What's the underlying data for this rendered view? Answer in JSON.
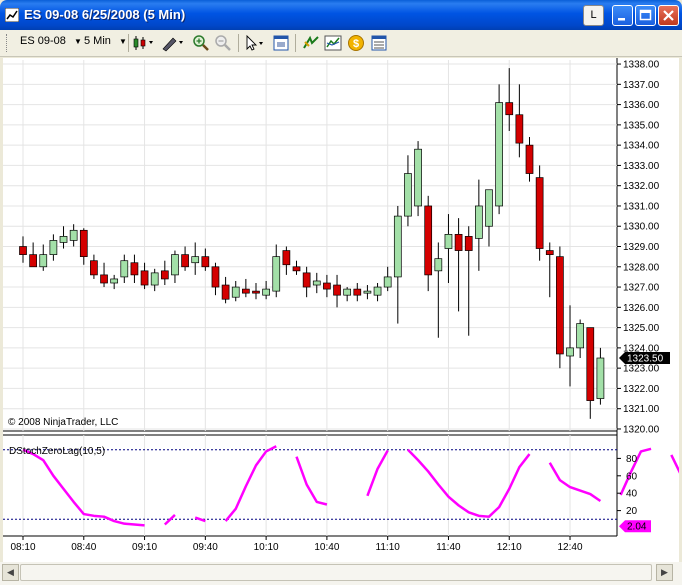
{
  "window": {
    "title": "ES 09-08  6/25/2008 (5 Min)",
    "l_button": "L"
  },
  "toolbar": {
    "instrument": "ES 09-08",
    "interval": "5 Min"
  },
  "colors": {
    "up": "#a3e0a8",
    "down": "#d40000",
    "indicator": "#ff00ff",
    "last_price_bg": "#000000",
    "indicator_last_bg": "#ff00ff"
  },
  "chart_data": [
    {
      "type": "candlestick",
      "price_axis": {
        "ticks": [
          "1338.00",
          "1337.00",
          "1336.00",
          "1335.00",
          "1334.00",
          "1333.00",
          "1332.00",
          "1331.00",
          "1330.00",
          "1329.00",
          "1328.00",
          "1327.00",
          "1326.00",
          "1325.00",
          "1324.00",
          "1323.00",
          "1322.00",
          "1321.00",
          "1320.00"
        ],
        "range": [
          1319.9,
          1338.2
        ]
      },
      "time_axis": {
        "ticks": [
          "08:10",
          "08:40",
          "09:10",
          "09:40",
          "10:10",
          "10:40",
          "11:10",
          "11:40",
          "12:10",
          "12:40"
        ]
      },
      "last_price": "1323.50",
      "copyright": "© 2008 NinjaTrader, LLC",
      "candles": [
        {
          "o": 1329.0,
          "h": 1329.5,
          "l": 1328.2,
          "c": 1328.6
        },
        {
          "o": 1328.6,
          "h": 1329.2,
          "l": 1328.0,
          "c": 1328.0
        },
        {
          "o": 1328.0,
          "h": 1329.1,
          "l": 1327.8,
          "c": 1328.6
        },
        {
          "o": 1328.6,
          "h": 1329.6,
          "l": 1328.3,
          "c": 1329.3
        },
        {
          "o": 1329.2,
          "h": 1330.0,
          "l": 1328.9,
          "c": 1329.5
        },
        {
          "o": 1329.3,
          "h": 1330.1,
          "l": 1329.0,
          "c": 1329.8
        },
        {
          "o": 1329.8,
          "h": 1329.9,
          "l": 1328.1,
          "c": 1328.5
        },
        {
          "o": 1328.3,
          "h": 1328.6,
          "l": 1327.4,
          "c": 1327.6
        },
        {
          "o": 1327.6,
          "h": 1328.2,
          "l": 1327.0,
          "c": 1327.2
        },
        {
          "o": 1327.2,
          "h": 1327.6,
          "l": 1326.9,
          "c": 1327.4
        },
        {
          "o": 1327.5,
          "h": 1328.6,
          "l": 1327.2,
          "c": 1328.3
        },
        {
          "o": 1328.2,
          "h": 1328.6,
          "l": 1327.2,
          "c": 1327.6
        },
        {
          "o": 1327.8,
          "h": 1328.2,
          "l": 1326.9,
          "c": 1327.1
        },
        {
          "o": 1327.1,
          "h": 1327.9,
          "l": 1326.8,
          "c": 1327.7
        },
        {
          "o": 1327.8,
          "h": 1328.3,
          "l": 1327.1,
          "c": 1327.4
        },
        {
          "o": 1327.6,
          "h": 1328.8,
          "l": 1327.2,
          "c": 1328.6
        },
        {
          "o": 1328.6,
          "h": 1329.0,
          "l": 1327.8,
          "c": 1328.0
        },
        {
          "o": 1328.2,
          "h": 1329.2,
          "l": 1327.6,
          "c": 1328.5
        },
        {
          "o": 1328.5,
          "h": 1328.9,
          "l": 1327.8,
          "c": 1328.0
        },
        {
          "o": 1328.0,
          "h": 1328.2,
          "l": 1326.6,
          "c": 1327.0
        },
        {
          "o": 1327.1,
          "h": 1327.5,
          "l": 1326.2,
          "c": 1326.4
        },
        {
          "o": 1326.5,
          "h": 1327.3,
          "l": 1326.3,
          "c": 1327.0
        },
        {
          "o": 1326.9,
          "h": 1327.4,
          "l": 1326.5,
          "c": 1326.7
        },
        {
          "o": 1326.8,
          "h": 1327.2,
          "l": 1326.4,
          "c": 1326.7
        },
        {
          "o": 1326.6,
          "h": 1327.3,
          "l": 1326.4,
          "c": 1326.9
        },
        {
          "o": 1326.8,
          "h": 1329.1,
          "l": 1326.5,
          "c": 1328.5
        },
        {
          "o": 1328.8,
          "h": 1329.0,
          "l": 1327.6,
          "c": 1328.1
        },
        {
          "o": 1328.0,
          "h": 1328.3,
          "l": 1327.6,
          "c": 1327.8
        },
        {
          "o": 1327.7,
          "h": 1328.0,
          "l": 1326.5,
          "c": 1327.0
        },
        {
          "o": 1327.1,
          "h": 1327.7,
          "l": 1326.7,
          "c": 1327.3
        },
        {
          "o": 1327.2,
          "h": 1327.6,
          "l": 1326.5,
          "c": 1326.9
        },
        {
          "o": 1327.1,
          "h": 1327.6,
          "l": 1326.0,
          "c": 1326.6
        },
        {
          "o": 1326.6,
          "h": 1327.0,
          "l": 1326.3,
          "c": 1326.9
        },
        {
          "o": 1326.9,
          "h": 1327.2,
          "l": 1326.3,
          "c": 1326.6
        },
        {
          "o": 1326.7,
          "h": 1327.1,
          "l": 1326.4,
          "c": 1326.8
        },
        {
          "o": 1326.6,
          "h": 1327.2,
          "l": 1326.3,
          "c": 1327.0
        },
        {
          "o": 1327.0,
          "h": 1328.0,
          "l": 1326.8,
          "c": 1327.5
        },
        {
          "o": 1327.5,
          "h": 1331.0,
          "l": 1325.2,
          "c": 1330.5
        },
        {
          "o": 1330.5,
          "h": 1333.5,
          "l": 1330.0,
          "c": 1332.6
        },
        {
          "o": 1331.0,
          "h": 1334.2,
          "l": 1330.5,
          "c": 1333.8
        },
        {
          "o": 1331.0,
          "h": 1331.5,
          "l": 1326.8,
          "c": 1327.6
        },
        {
          "o": 1327.8,
          "h": 1329.2,
          "l": 1324.5,
          "c": 1328.4
        },
        {
          "o": 1328.9,
          "h": 1330.6,
          "l": 1327.2,
          "c": 1329.6
        },
        {
          "o": 1329.6,
          "h": 1330.4,
          "l": 1325.8,
          "c": 1328.8
        },
        {
          "o": 1329.5,
          "h": 1330.0,
          "l": 1324.6,
          "c": 1328.8
        },
        {
          "o": 1329.4,
          "h": 1332.3,
          "l": 1327.8,
          "c": 1331.0
        },
        {
          "o": 1330.0,
          "h": 1331.8,
          "l": 1329.0,
          "c": 1331.8
        },
        {
          "o": 1331.0,
          "h": 1337.0,
          "l": 1330.6,
          "c": 1336.1
        },
        {
          "o": 1336.1,
          "h": 1337.8,
          "l": 1334.7,
          "c": 1335.5
        },
        {
          "o": 1335.5,
          "h": 1337.0,
          "l": 1333.4,
          "c": 1334.1
        },
        {
          "o": 1334.0,
          "h": 1334.4,
          "l": 1332.2,
          "c": 1332.6
        },
        {
          "o": 1332.4,
          "h": 1333.0,
          "l": 1328.3,
          "c": 1328.9
        },
        {
          "o": 1328.8,
          "h": 1329.2,
          "l": 1326.5,
          "c": 1328.6
        },
        {
          "o": 1328.5,
          "h": 1329.0,
          "l": 1323.0,
          "c": 1323.7
        },
        {
          "o": 1323.6,
          "h": 1326.1,
          "l": 1322.1,
          "c": 1324.0
        },
        {
          "o": 1324.0,
          "h": 1325.4,
          "l": 1323.5,
          "c": 1325.2
        },
        {
          "o": 1325.0,
          "h": 1325.0,
          "l": 1320.5,
          "c": 1321.4
        },
        {
          "o": 1321.5,
          "h": 1324.0,
          "l": 1321.2,
          "c": 1323.5
        }
      ]
    },
    {
      "type": "line",
      "title": "DStochZeroLag(10,5)",
      "y_axis": {
        "ticks": [
          "80",
          "60",
          "40",
          "20"
        ],
        "range": [
          0,
          100
        ]
      },
      "levels": [
        10,
        90
      ],
      "last_value": "2.04",
      "values": [
        90,
        85,
        78,
        60,
        45,
        30,
        16,
        14,
        13,
        8,
        5,
        4,
        3,
        null,
        4,
        15,
        null,
        12,
        8,
        null,
        8,
        22,
        48,
        72,
        88,
        94,
        null,
        82,
        50,
        30,
        27,
        null,
        null,
        null,
        37,
        68,
        89,
        null,
        90,
        78,
        65,
        50,
        36,
        26,
        18,
        14,
        13,
        24,
        45,
        70,
        85,
        null,
        75,
        55,
        47,
        43,
        39,
        31,
        null,
        38,
        64,
        88,
        91,
        null,
        84,
        60,
        27,
        13,
        7,
        5,
        4,
        3,
        2
      ]
    }
  ]
}
